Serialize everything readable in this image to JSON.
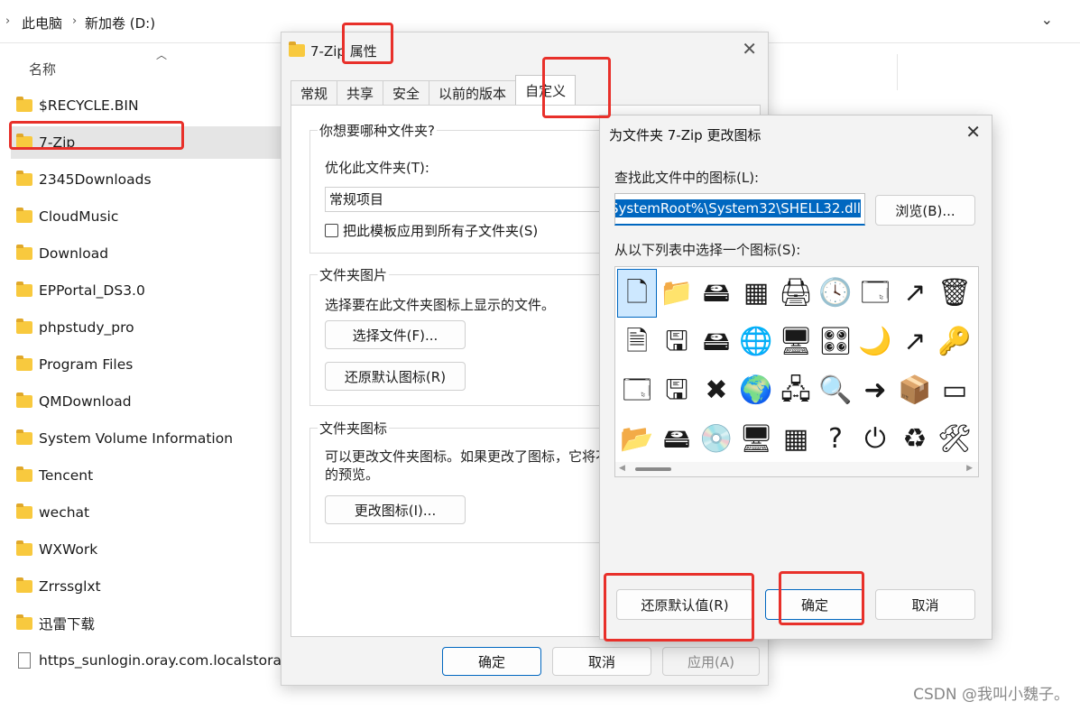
{
  "explorer": {
    "breadcrumb": [
      "此电脑",
      "新加卷 (D:)"
    ],
    "column_header": "名称",
    "files": [
      {
        "name": "$RECYCLE.BIN",
        "kind": "folder"
      },
      {
        "name": "7-Zip",
        "kind": "folder",
        "selected": true
      },
      {
        "name": "2345Downloads",
        "kind": "folder"
      },
      {
        "name": "CloudMusic",
        "kind": "folder"
      },
      {
        "name": "Download",
        "kind": "folder"
      },
      {
        "name": "EPPortal_DS3.0",
        "kind": "folder"
      },
      {
        "name": "phpstudy_pro",
        "kind": "folder"
      },
      {
        "name": "Program Files",
        "kind": "folder"
      },
      {
        "name": "QMDownload",
        "kind": "folder"
      },
      {
        "name": "System Volume Information",
        "kind": "folder"
      },
      {
        "name": "Tencent",
        "kind": "folder"
      },
      {
        "name": "wechat",
        "kind": "folder"
      },
      {
        "name": "WXWork",
        "kind": "folder"
      },
      {
        "name": "Zrrssglxt",
        "kind": "folder"
      },
      {
        "name": "迅雷下载",
        "kind": "folder"
      },
      {
        "name": "https_sunlogin.oray.com.localstorage",
        "kind": "file"
      }
    ]
  },
  "properties": {
    "title": "7-Zip 属性",
    "tabs": [
      "常规",
      "共享",
      "安全",
      "以前的版本",
      "自定义"
    ],
    "active_tab": "自定义",
    "group_folder_type": {
      "label": "你想要哪种文件夹?",
      "optimize_label": "优化此文件夹(T):",
      "optimize_value": "常规项目",
      "apply_checkbox": "把此模板应用到所有子文件夹(S)"
    },
    "group_folder_picture": {
      "label": "文件夹图片",
      "description": "选择要在此文件夹图标上显示的文件。",
      "choose_file_button": "选择文件(F)...",
      "restore_default_button": "还原默认图标(R)"
    },
    "group_folder_icon": {
      "label": "文件夹图标",
      "description_line1": "可以更改文件夹图标。如果更改了图标，它将不",
      "description_line2": "的预览。",
      "change_icon_button": "更改图标(I)..."
    },
    "ok_button": "确定",
    "cancel_button": "取消",
    "apply_button": "应用(A)"
  },
  "change_icon": {
    "title": "为文件夹 7-Zip 更改图标",
    "find_label": "查找此文件中的图标(L):",
    "path_value": "SystemRoot%\\System32\\SHELL32.dll",
    "browse_button": "浏览(B)...",
    "list_label": "从以下列表中选择一个图标(S):",
    "icons": [
      "blank-document-icon",
      "folder-icon",
      "drive-icon",
      "chip-icon",
      "printer-icon",
      "document-clock-icon",
      "window-shortcut-icon",
      "shortcut-arrow-icon",
      "recycle-bin-full-icon",
      "text-document-icon",
      "floppy-drive-icon",
      "removable-drive-icon",
      "globe-icon",
      "network-computer-icon",
      "control-panel-icon",
      "monitor-moon-icon",
      "shortcut-arrow-small-icon",
      "folder-key-icon",
      "application-window-icon",
      "floppy-drive-2-icon",
      "disconnected-drive-icon",
      "network-globe-icon",
      "network-devices-icon",
      "search-magnifier-icon",
      "run-arrow-icon",
      "box-icon",
      "blue-panel-icon",
      "yellow-folder-icon",
      "hard-drive-icon",
      "cd-drive-icon",
      "monitor-icon",
      "folder-grid-icon",
      "help-question-icon",
      "power-icon",
      "recycle-bin-empty-icon",
      "folder-tools-icon"
    ],
    "icon_glyphs": [
      "🗋",
      "📁",
      "🖴",
      "▦",
      "🖨",
      "🕓",
      "🗔",
      "↗",
      "🗑",
      "🗎",
      "🖫",
      "🖴",
      "🌐",
      "🖥",
      "🎛",
      "🌙",
      "↗",
      "🔑",
      "🗔",
      "🖫",
      "✖",
      "🌍",
      "🖧",
      "🔍",
      "➜",
      "📦",
      "▭",
      "📂",
      "🖴",
      "💿",
      "🖥",
      "▦",
      "?",
      "⏻",
      "♻",
      "🛠"
    ],
    "restore_default_button": "还原默认值(R)",
    "ok_button": "确定",
    "cancel_button": "取消"
  },
  "watermark": "CSDN @我叫小魏子。"
}
